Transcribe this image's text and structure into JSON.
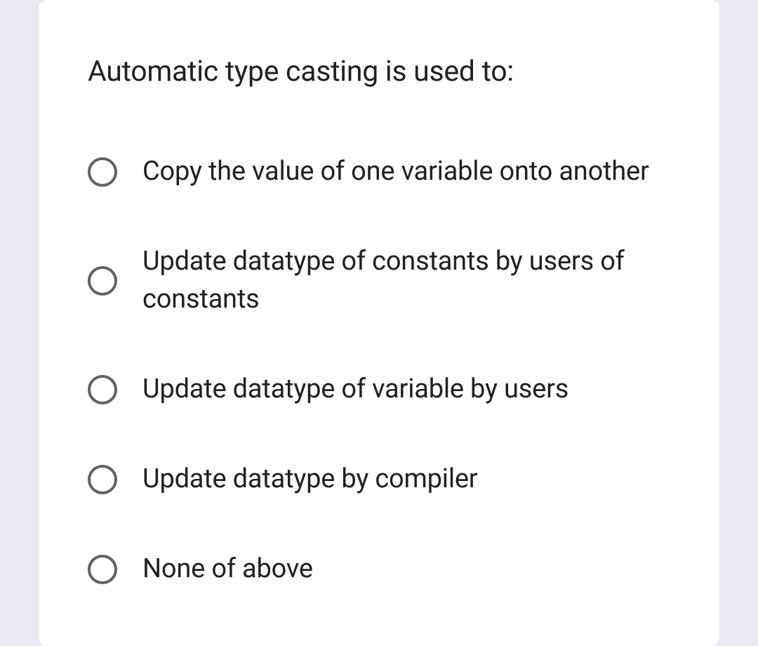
{
  "question": {
    "text": "Automatic type casting is used to:",
    "options": [
      {
        "label": "Copy the value of one variable onto another"
      },
      {
        "label": "Update datatype of constants by users of constants"
      },
      {
        "label": "Update datatype of variable by users"
      },
      {
        "label": "Update datatype by compiler"
      },
      {
        "label": "None of above"
      }
    ]
  }
}
